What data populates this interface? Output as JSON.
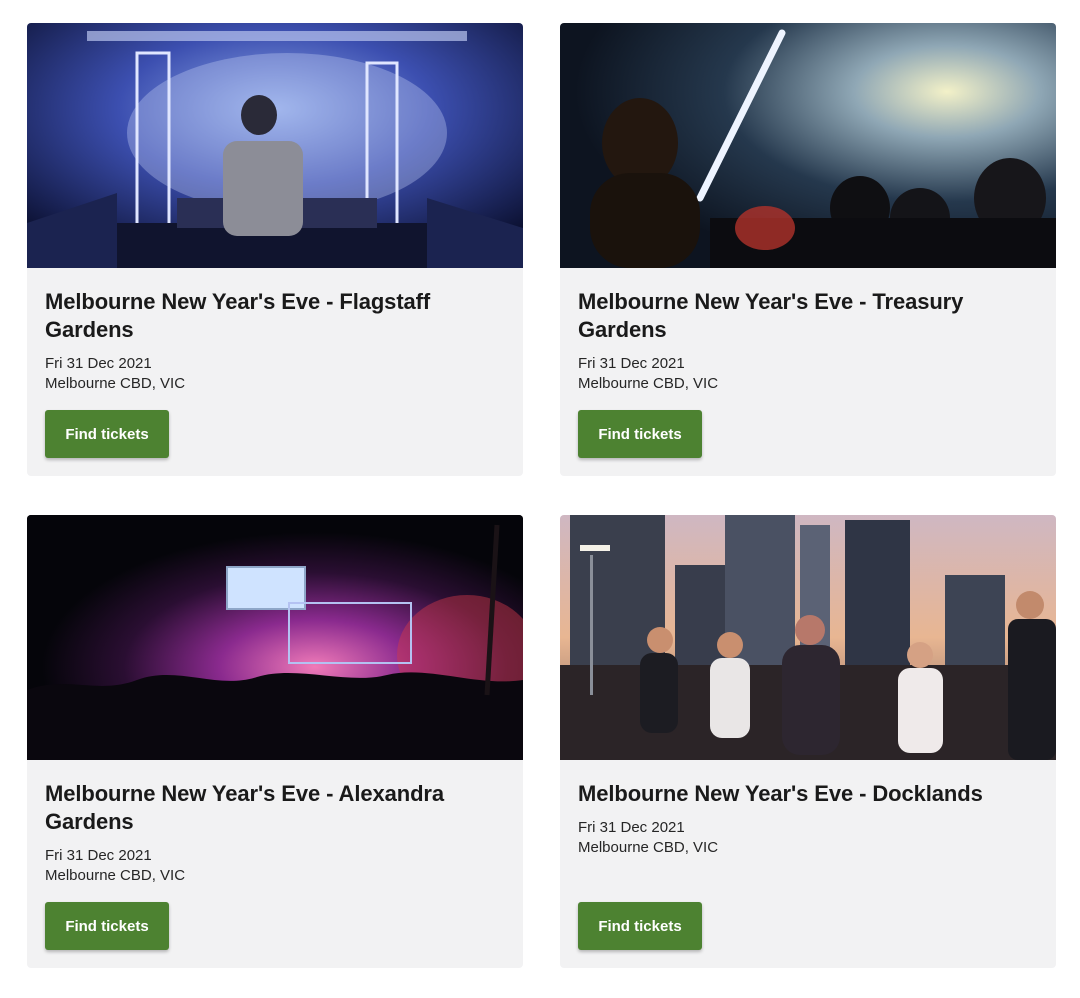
{
  "events": [
    {
      "title": "Melbourne New Year's Eve - Flagstaff Gardens",
      "date": "Fri 31 Dec 2021",
      "location": "Melbourne CBD, VIC",
      "button_label": "Find tickets"
    },
    {
      "title": "Melbourne New Year's Eve - Treasury Gardens",
      "date": "Fri 31 Dec 2021",
      "location": "Melbourne CBD, VIC",
      "button_label": "Find tickets"
    },
    {
      "title": "Melbourne New Year's Eve - Alexandra Gardens",
      "date": "Fri 31 Dec 2021",
      "location": "Melbourne CBD, VIC",
      "button_label": "Find tickets"
    },
    {
      "title": "Melbourne New Year's Eve - Docklands",
      "date": "Fri 31 Dec 2021",
      "location": "Melbourne CBD, VIC",
      "button_label": "Find tickets"
    }
  ],
  "colors": {
    "button": "#4d8231",
    "card_background": "#f2f2f3",
    "title_text": "#1a1a1a"
  }
}
